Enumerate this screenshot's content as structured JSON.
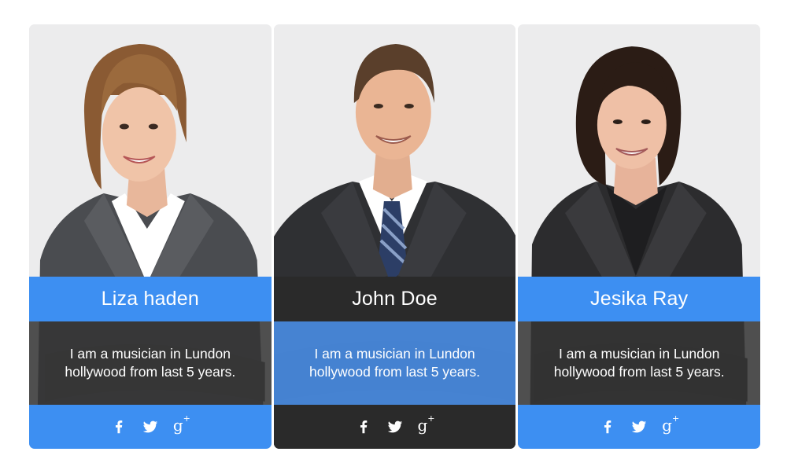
{
  "colors": {
    "blue": "#3d8ff2",
    "dark": "#2a2a2a",
    "dark_overlay": "rgba(52,52,52,0.86)",
    "blue_overlay": "rgba(76,150,245,0.82)",
    "card_bg": "#ececed"
  },
  "cards": [
    {
      "name": "Liza haden",
      "desc_line1": "I am a musician in Lundon",
      "desc_line2": "hollywood from last 5 years.",
      "social": [
        "facebook-icon",
        "twitter-icon",
        "google-plus-icon"
      ]
    },
    {
      "name": "John Doe",
      "desc_line1": "I am a musician in Lundon",
      "desc_line2": "hollywood from last 5 years.",
      "social": [
        "facebook-icon",
        "twitter-icon",
        "google-plus-icon"
      ]
    },
    {
      "name": "Jesika Ray",
      "desc_line1": "I am a musician in Lundon",
      "desc_line2": "hollywood from last 5 years.",
      "social": [
        "facebook-icon",
        "twitter-icon",
        "google-plus-icon"
      ]
    }
  ],
  "social_labels": {
    "gplus": "g",
    "gplus_sup": "+"
  }
}
